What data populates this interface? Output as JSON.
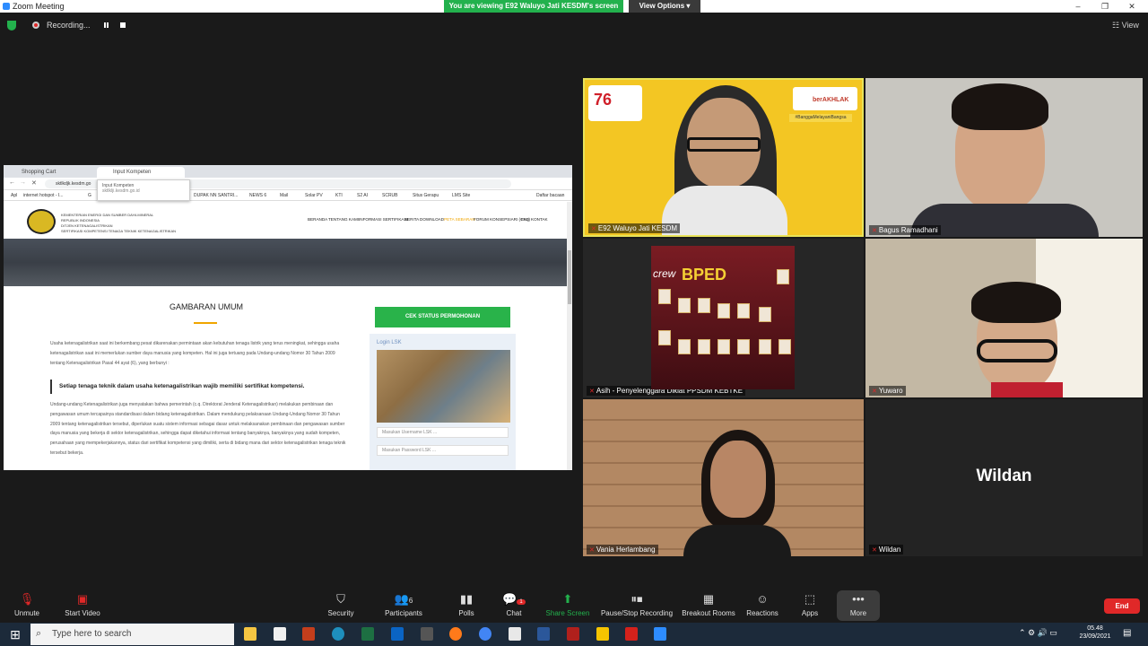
{
  "window": {
    "title": "Zoom Meeting",
    "controls": [
      "–",
      "❐",
      "✕"
    ]
  },
  "banner": {
    "viewing": "You are viewing E92 Waluyo Jati KESDM's screen",
    "view_options": "View Options ▾"
  },
  "recording": {
    "label": "Recording...",
    "view": "View"
  },
  "browser": {
    "tabs": [
      "Shopping Cart",
      "Input Kompeten"
    ],
    "tooltip": {
      "title": "Input Kompeten",
      "url": "sktlklji.kesdm.go.id"
    },
    "url": "sktlkdjk.kesdm.go",
    "bookmarks": [
      "Apl",
      "internet hotspot - I...",
      "G",
      "DUPAK NN SANTRI...",
      "NEWS 6",
      "Mail",
      "Solar PV",
      "KTI",
      "S2 AI",
      "SCRUB",
      "Situs Gerapu",
      "LMS Site",
      "Daftar bacaan"
    ],
    "org_lines": [
      "KEMENTERIAN ENERGI DAN SUMBER DAYA MINERAL",
      "REPUBLIK INDONESIA",
      "DITJEN KETENAGALISTRIKAN",
      "SERTIFIKASI KOMPETENSI TENAGA TEKNIK KETENAGALISTRIKAN"
    ],
    "nav": [
      "BERANDA",
      "TENTANG KAMI",
      "INFORMASI SERTIFIKASI",
      "BERITA",
      "DOWNLOAD",
      "PETA SEBARAN",
      "FORUM KONSEPSIARI (CSE)",
      "FAQ",
      "KONTAK"
    ],
    "heading": "GAMBARAN UMUM",
    "para1": "Usaha ketenagalistrikan saat ini berkembang pesat dikarenakan permintaan akan kebutuhan tenaga listrik yang terus meningkat, sehingga usaha ketenagalistrikan saat ini memerlukan sumber daya manusia yang kompeten. Hal ini juga tertuang pada Undang-undang Nomor 30 Tahun 2009 tentang Ketenagalistrikan Pasal 44 ayat (6), yang berbunyi :",
    "quote": "Setiap tenaga teknik dalam usaha ketenagalistrikan wajib memiliki sertifikat kompetensi.",
    "para2": "Undang-undang Ketenagalistrikan juga menyatakan bahwa pemerintah (c.q. Direktorat Jenderal Ketenagalistrikan) melakukan pembinaan dan pengawasan umum tercapainya standardisasi dalam bidang ketenagalistrikan. Dalam mendukung pelaksanaan Undang-Undang Nomor 30 Tahun 2009 tentang ketenagalistrikan tersebut, diperlukan suatu sistem informasi sebagai dasar untuk melaksanakan pembinaan dan pengawasan sumber daya manusia yang bekerja di sektor ketenagalistrikan, sehingga dapat diketahui informasi tentang banyaknya, banyaknya yang sudah kompeten, perusahaan yang mempekerjakannya, status dari sertifikat kompetensi yang dimiliki, serta di bidang mana dari sektor ketenagalistrikan tenaga teknik tersebut bekerja.",
    "cek_button": "CEK STATUS PERMOHONAN",
    "login_title": "Login LSK",
    "username_placeholder": "Masukan Username LSK ...",
    "password_placeholder": "Masukan Password LSK ..."
  },
  "tiles": [
    {
      "name": "E92 Waluyo Jati KESDM",
      "badge": "berAKHLAK",
      "tag": "#BanggaMelayaniBangsa",
      "num": "76"
    },
    {
      "name": "Bagus Ramadhani"
    },
    {
      "name": "Asih - Penyelenggara Diklat PPSDM KEBTKE",
      "poster_title": "BPED",
      "poster_crew": "crew"
    },
    {
      "name": "Yuwaro"
    },
    {
      "name": "Vania Herlambang"
    },
    {
      "name": "Wildan",
      "big_label": "Wildan"
    }
  ],
  "toolbar": {
    "unmute": "Unmute",
    "start_video": "Start Video",
    "security": "Security",
    "participants": "Participants",
    "participants_count": "6",
    "polls": "Polls",
    "chat": "Chat",
    "chat_badge": "1",
    "share": "Share Screen",
    "record": "Pause/Stop Recording",
    "breakout": "Breakout Rooms",
    "reactions": "Reactions",
    "apps": "Apps",
    "more": "More",
    "end": "End"
  },
  "taskbar": {
    "search_placeholder": "Type here to search",
    "time": "05.48",
    "date": "23/09/2021"
  },
  "colors": {
    "share_green": "#23b14d",
    "end_red": "#e02828",
    "active_speaker": "#e8e35a"
  }
}
